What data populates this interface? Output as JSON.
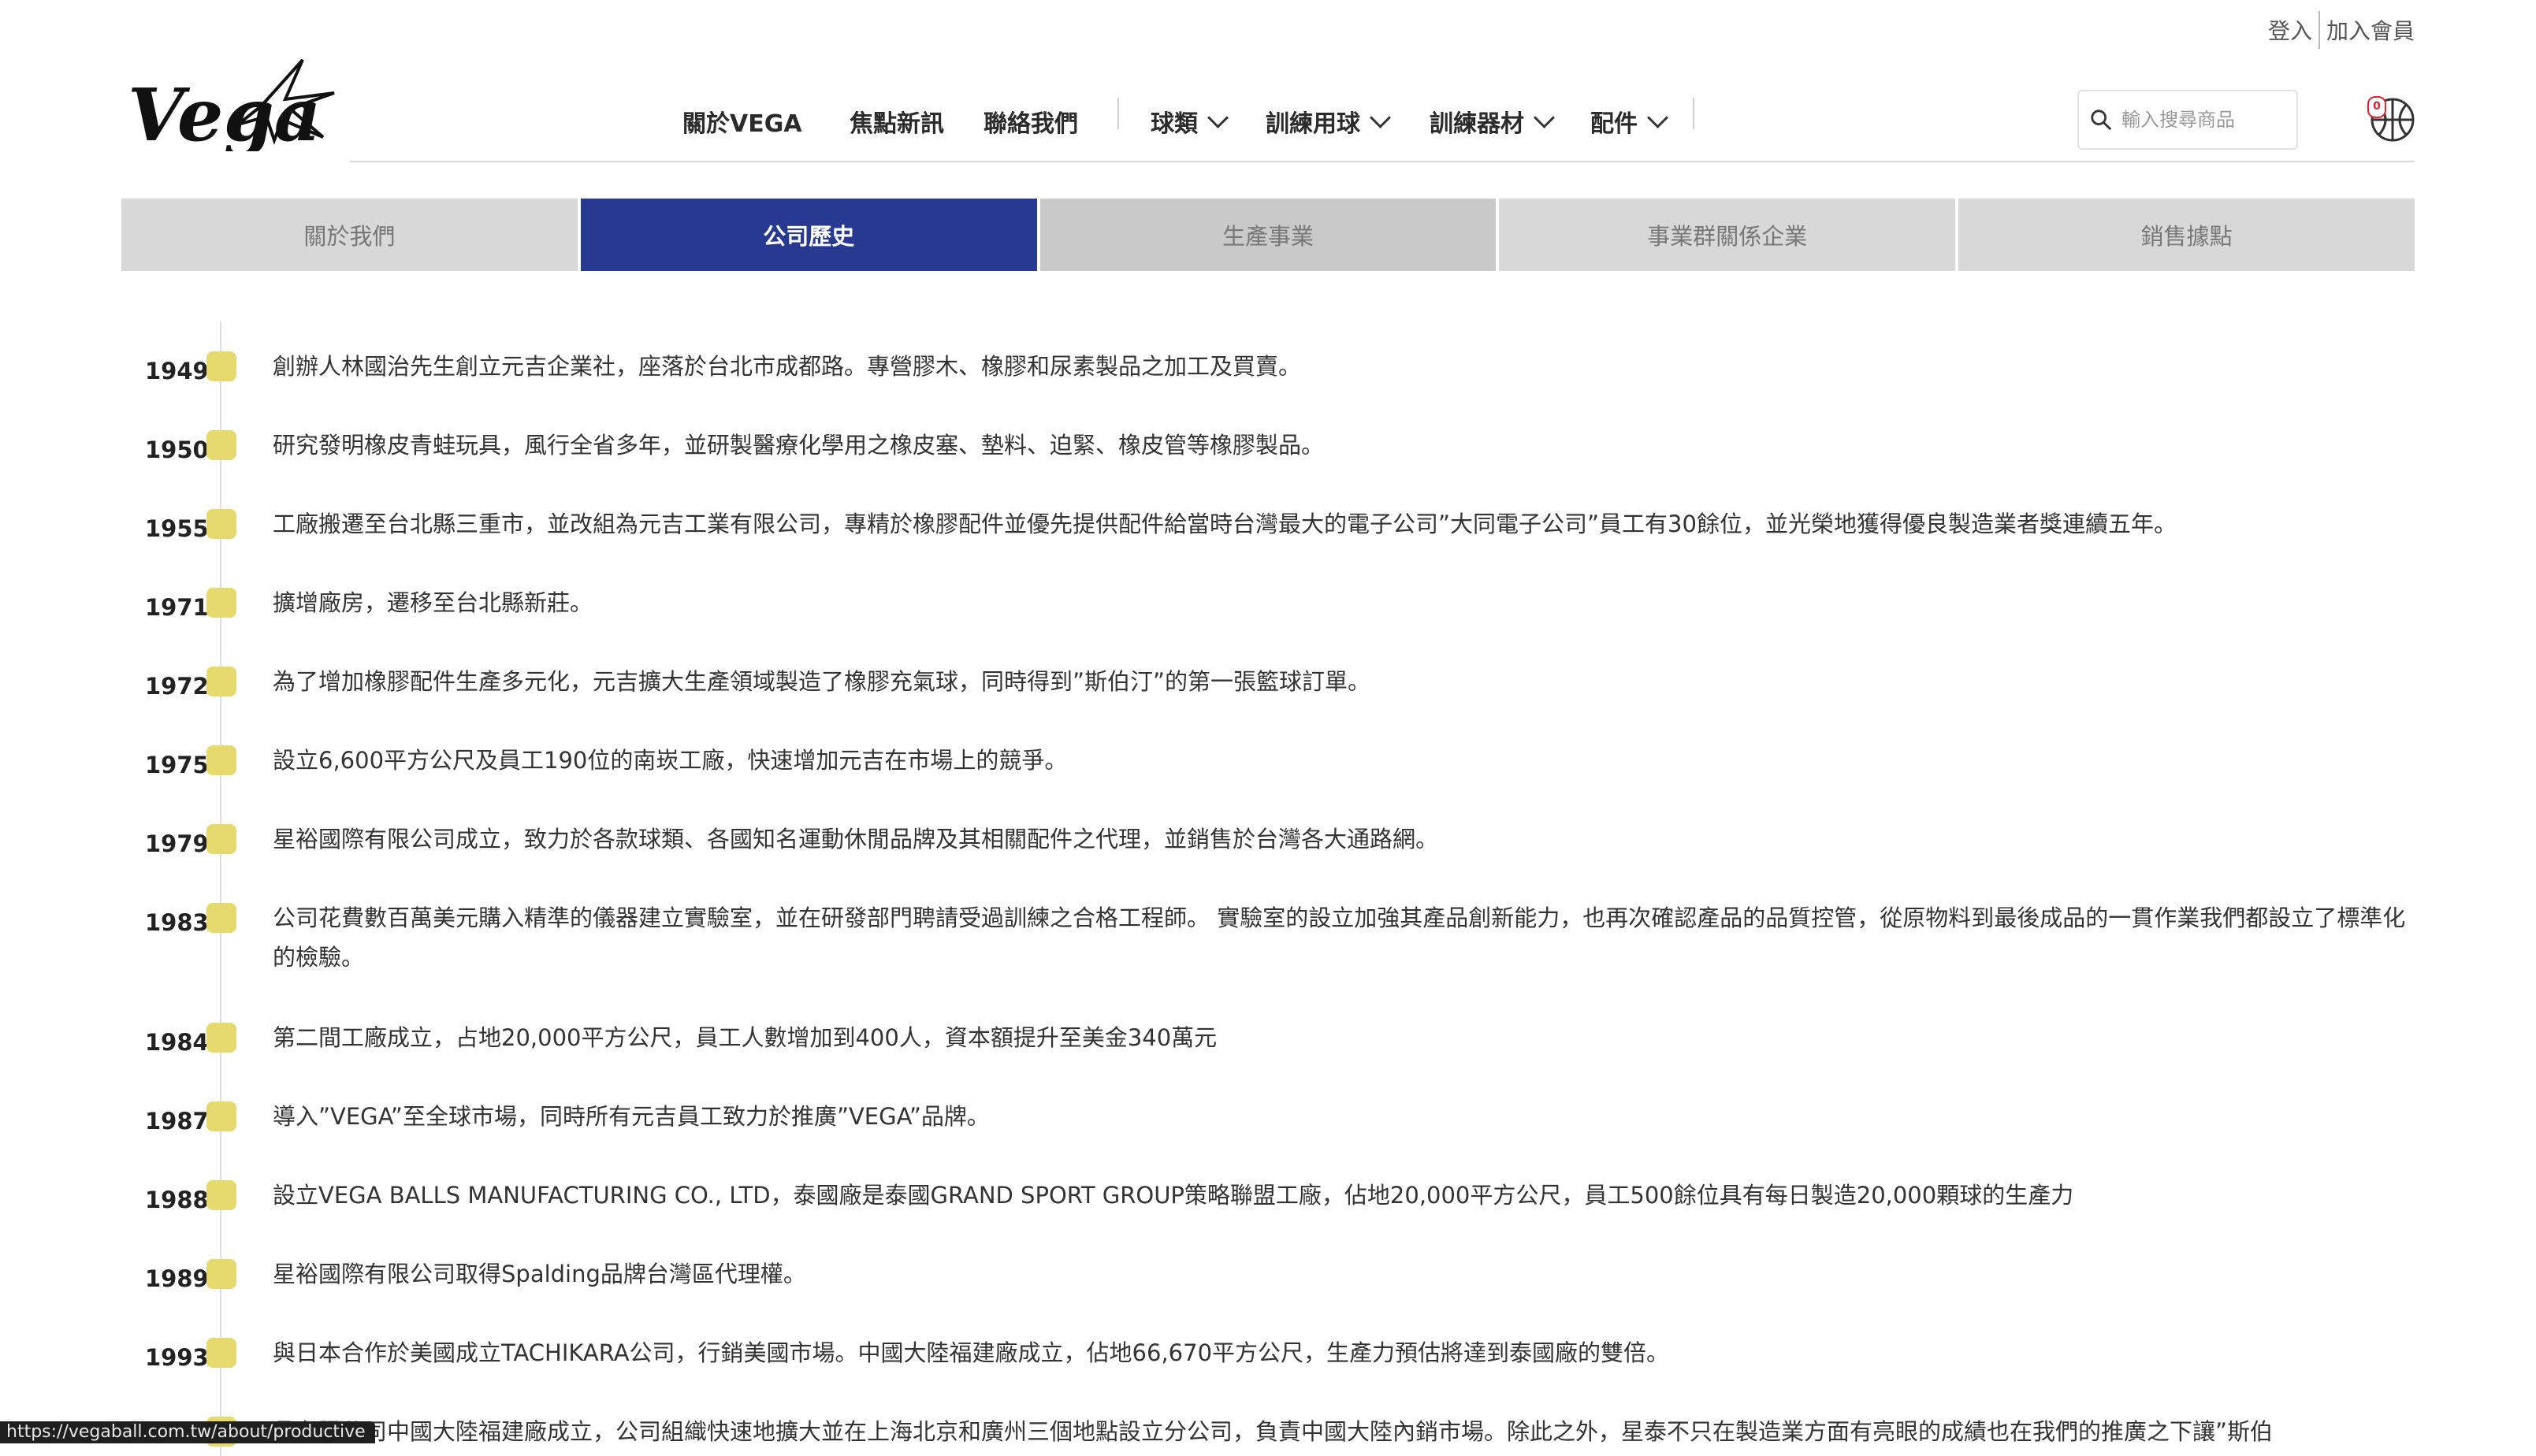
{
  "account": {
    "login": "登入",
    "join": "加入會員"
  },
  "logo_text": "Vega",
  "nav": {
    "items": [
      {
        "label": "關於VEGA",
        "dropdown": false
      },
      {
        "label": "焦點新訊",
        "dropdown": false
      },
      {
        "label": "聯絡我們",
        "dropdown": false
      },
      {
        "label": "球類",
        "dropdown": true
      },
      {
        "label": "訓練用球",
        "dropdown": true
      },
      {
        "label": "訓練器材",
        "dropdown": true
      },
      {
        "label": "配件",
        "dropdown": true
      }
    ]
  },
  "search": {
    "placeholder": "輸入搜尋商品",
    "value": ""
  },
  "cart": {
    "count": "0",
    "icon": "basketball-cart-icon"
  },
  "tabs": [
    {
      "label": "關於我們",
      "active": false
    },
    {
      "label": "公司歷史",
      "active": true
    },
    {
      "label": "生產事業",
      "active": false
    },
    {
      "label": "事業群關係企業",
      "active": false
    },
    {
      "label": "銷售據點",
      "active": false
    }
  ],
  "timeline": [
    {
      "year": "1949",
      "text": "創辦人林國治先生創立元吉企業社，座落於台北市成都路。專營膠木、橡膠和尿素製品之加工及買賣。"
    },
    {
      "year": "1950",
      "text": "研究發明橡皮青蛙玩具，風行全省多年，並研製醫療化學用之橡皮塞、墊料、迫緊、橡皮管等橡膠製品。"
    },
    {
      "year": "1955",
      "text": "工廠搬遷至台北縣三重市，並改組為元吉工業有限公司，專精於橡膠配件並優先提供配件給當時台灣最大的電子公司”大同電子公司”員工有30餘位，並光榮地獲得優良製造業者獎連續五年。"
    },
    {
      "year": "1971",
      "text": "擴增廠房，遷移至台北縣新莊。"
    },
    {
      "year": "1972",
      "text": "為了增加橡膠配件生產多元化，元吉擴大生產領域製造了橡膠充氣球，同時得到”斯伯汀”的第一張籃球訂單。"
    },
    {
      "year": "1975",
      "text": "設立6,600平方公尺及員工190位的南崁工廠，快速增加元吉在市場上的競爭。"
    },
    {
      "year": "1979",
      "text": "星裕國際有限公司成立，致力於各款球類、各國知名運動休閒品牌及其相關配件之代理，並銷售於台灣各大通路網。"
    },
    {
      "year": "1983",
      "text": "公司花費數百萬美元購入精準的儀器建立實驗室，並在研發部門聘請受過訓練之合格工程師。 實驗室的設立加強其產品創新能力，也再次確認產品的品質控管，從原物料到最後成品的一貫作業我們都設立了標準化的檢驗。"
    },
    {
      "year": "1984",
      "text": "第二間工廠成立，占地20,000平方公尺，員工人數增加到400人，資本額提升至美金340萬元"
    },
    {
      "year": "1987",
      "text": "導入”VEGA”至全球市場，同時所有元吉員工致力於推廣”VEGA”品牌。"
    },
    {
      "year": "1988",
      "text": "設立VEGA BALLS MANUFACTURING CO., LTD，泰國廠是泰國GRAND SPORT GROUP策略聯盟工廠，佔地20,000平方公尺，員工500餘位具有每日製造20,000顆球的生產力"
    },
    {
      "year": "1989",
      "text": "星裕國際有限公司取得Spalding品牌台灣區代理權。"
    },
    {
      "year": "1993",
      "text": "與日本合作於美國成立TACHIKARA公司，行銷美國市場。中國大陸福建廠成立，佔地66,670平方公尺，生產力預估將達到泰國廠的雙倍。"
    },
    {
      "year": "",
      "text": "品有限公司中國大陸福建廠成立，公司組織快速地擴大並在上海北京和廣州三個地點設立分公司，負責中國大陸內銷市場。除此之外，星泰不只在製造業方面有亮眼的成績也在我們的推廣之下讓”斯伯"
    }
  ],
  "status_url": "https://vegaball.com.tw/about/productive",
  "colors": {
    "accent": "#273990",
    "marker": "#e6da6e",
    "tab_bg": "#d8d8d8"
  }
}
